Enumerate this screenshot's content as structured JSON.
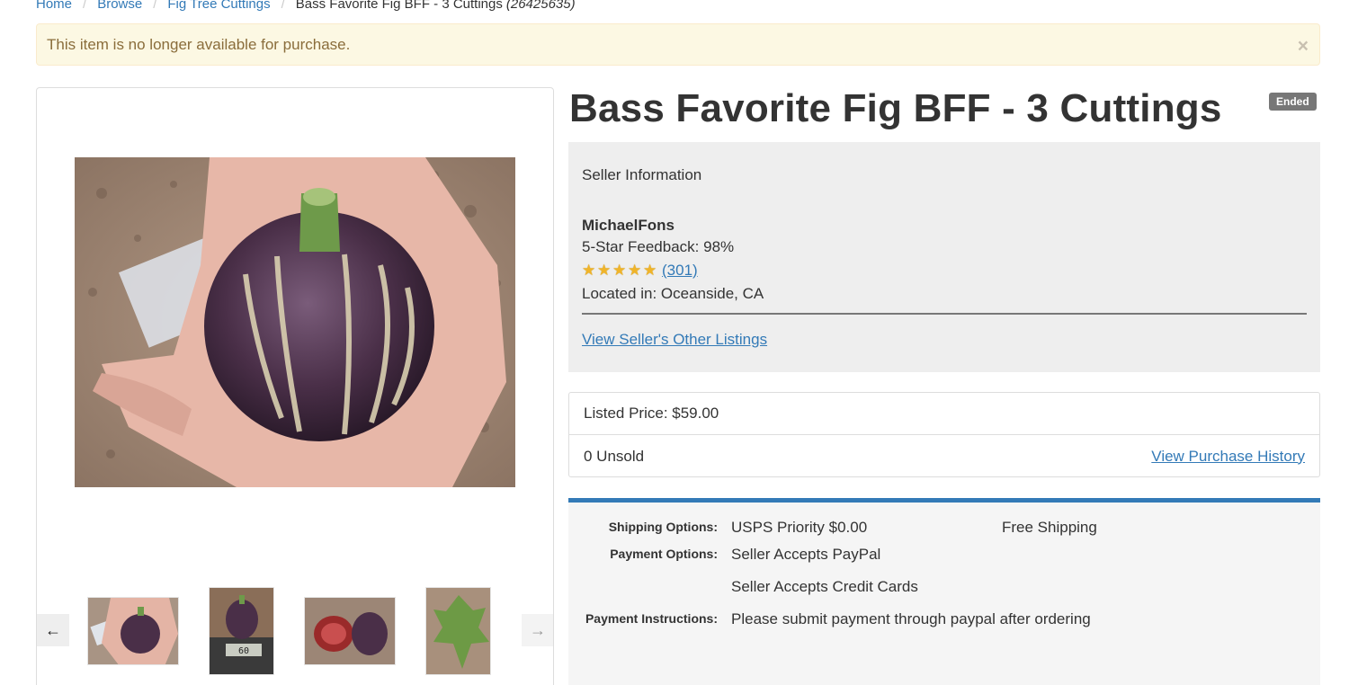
{
  "breadcrumb": {
    "home": "Home",
    "browse": "Browse",
    "category": "Fig Tree Cuttings",
    "current": "Bass Favorite Fig BFF - 3 Cuttings",
    "current_id": "(26425635)"
  },
  "alert": {
    "message": "This item is no longer available for purchase.",
    "close": "×"
  },
  "listing": {
    "title": "Bass Favorite Fig BFF - 3 Cuttings",
    "status_badge": "Ended"
  },
  "gallery": {
    "prev_icon": "←",
    "next_icon": "→",
    "thumbnail_count": 4,
    "thumb_scale_reading": "60"
  },
  "seller": {
    "heading": "Seller Information",
    "name": "MichaelFons",
    "feedback": "5-Star Feedback: 98%",
    "rating_stars": 5,
    "rating_count": "(301)",
    "location": "Located in: Oceanside, CA",
    "other_listings_link": "View Seller's Other Listings"
  },
  "pricing": {
    "listed_price": "Listed Price: $59.00",
    "unsold": "0 Unsold",
    "purchase_history_link": "View Purchase History"
  },
  "details": {
    "shipping_label": "Shipping Options:",
    "shipping_method": "USPS Priority $0.00",
    "shipping_note": "Free Shipping",
    "payment_label": "Payment Options:",
    "payment_option_1": "Seller Accepts PayPal",
    "payment_option_2": "Seller Accepts Credit Cards",
    "instructions_label": "Payment Instructions:",
    "instructions": "Please submit payment through paypal after ordering"
  },
  "colors": {
    "link": "#337ab7",
    "alert_bg": "#fcf8e3",
    "alert_text": "#8a6d3b",
    "badge_bg": "#777777",
    "accent_bar": "#337ab7"
  }
}
